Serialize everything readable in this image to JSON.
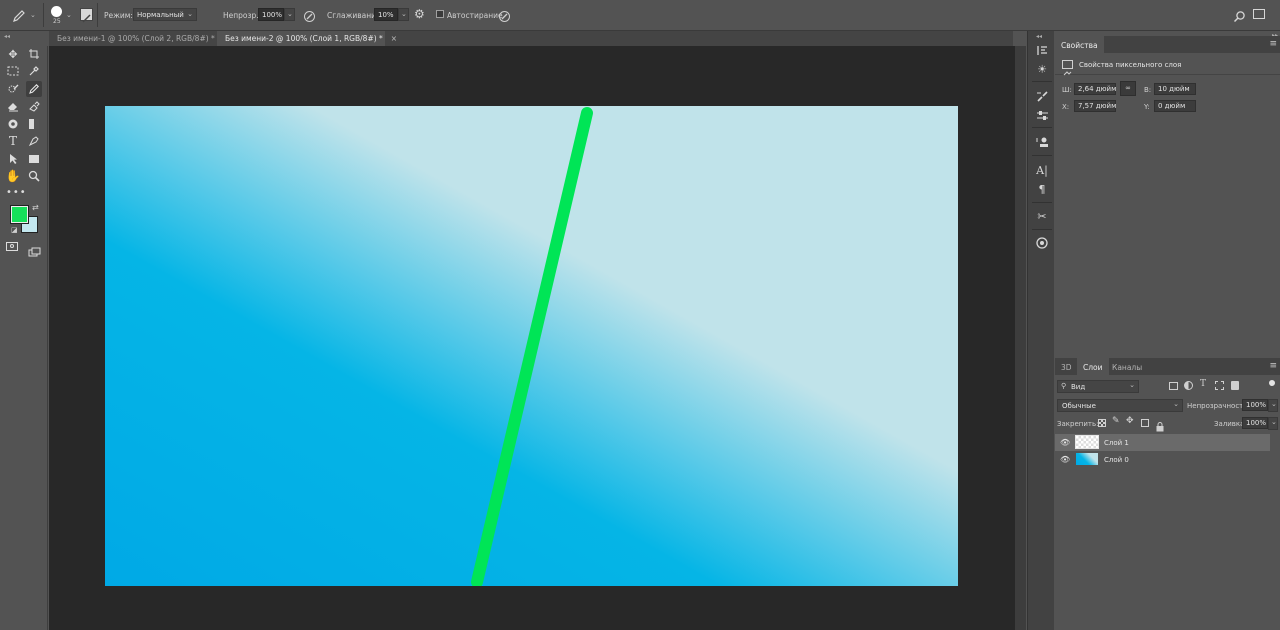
{
  "options_bar": {
    "brush_size": "25",
    "mode_label": "Режим:",
    "mode_value": "Нормальный",
    "opacity_label": "Непрозр.:",
    "opacity_value": "100%",
    "smoothing_label": "Сглаживание:",
    "smoothing_value": "10%",
    "auto_erase_label": "Автостирание"
  },
  "tabs": [
    {
      "label": "Без имени-1 @ 100% (Слой 2, RGB/8#) *",
      "active": false
    },
    {
      "label": "Без имени-2 @ 100% (Слой 1, RGB/8#) *",
      "active": true
    }
  ],
  "tab_close_glyph": "×",
  "colors": {
    "foreground": "#16e05a",
    "background": "#c3e7ef",
    "gradient_deep": "#00a9e6",
    "gradient_light": "#c0e3ea",
    "stroke": "#00e556"
  },
  "properties_panel": {
    "tab": "Свойства",
    "title": "Свойства пиксельного слоя",
    "w_label": "Ш:",
    "w_value": "2,64 дюйм",
    "h_label": "В:",
    "h_value": "10 дюйм",
    "x_label": "X:",
    "x_value": "7,57 дюйм",
    "y_label": "Y:",
    "y_value": "0 дюйм"
  },
  "layers_panel": {
    "tabs": [
      "3D",
      "Слои",
      "Каналы"
    ],
    "filter_value": "Вид",
    "blend_mode": "Обычные",
    "opacity_label": "Непрозрачность:",
    "opacity_value": "100%",
    "lock_label": "Закрепить:",
    "fill_label": "Заливка:",
    "fill_value": "100%",
    "layers": [
      {
        "name": "Слой 1",
        "selected": true,
        "thumb": "transparent"
      },
      {
        "name": "Слой 0",
        "selected": false,
        "thumb": "gradient"
      }
    ]
  },
  "tools": [
    "move-tool",
    "artboard-tool",
    "marquee-tool",
    "eyedropper-tool",
    "quick-selection-tool",
    "pencil-tool",
    "eraser-tool",
    "color-replacement-tool",
    "stamp-tool",
    "gradient-tool",
    "type-tool",
    "pen-tool",
    "path-selection-tool",
    "rectangle-tool",
    "hand-tool",
    "zoom-tool"
  ]
}
